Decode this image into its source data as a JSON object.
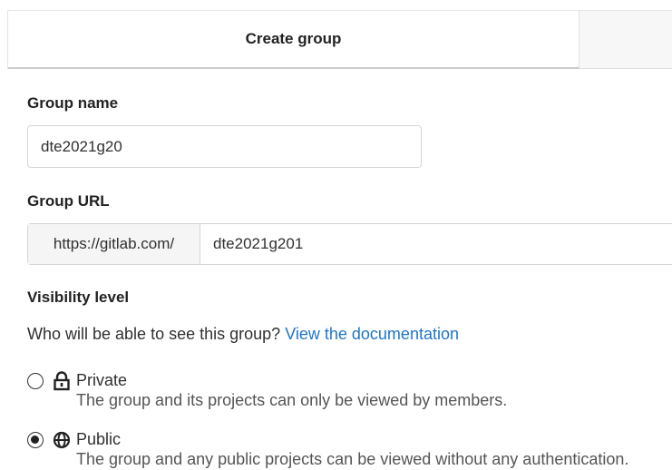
{
  "tabs": {
    "active_label": "Create group"
  },
  "group_name": {
    "label": "Group name",
    "value": "dte2021g20"
  },
  "group_url": {
    "label": "Group URL",
    "prefix": "https://gitlab.com/",
    "value": "dte2021g201"
  },
  "visibility": {
    "label": "Visibility level",
    "help_text": "Who will be able to see this group?",
    "help_link": "View the documentation",
    "options": [
      {
        "title": "Private",
        "description": "The group and its projects can only be viewed by members.",
        "icon": "lock-icon",
        "checked": false
      },
      {
        "title": "Public",
        "description": "The group and any public projects can be viewed without any authentication.",
        "icon": "globe-icon",
        "checked": true
      }
    ]
  },
  "colors": {
    "link": "#1f75cb",
    "text": "#303030",
    "border": "#d5d5d5"
  }
}
